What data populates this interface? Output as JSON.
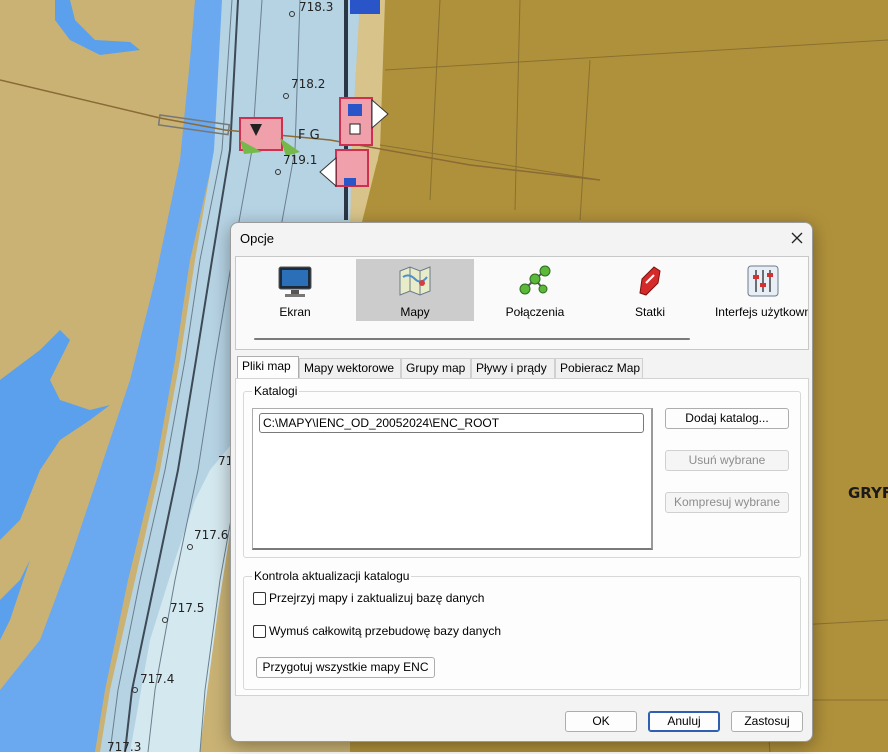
{
  "map": {
    "depth_labels": [
      "718.3",
      "718.2",
      "719.1",
      "717.6",
      "717.5",
      "717.4",
      "717.3",
      "71"
    ],
    "light_label": "F G",
    "place_label": "GRYF"
  },
  "dialog": {
    "title": "Opcje",
    "toolbar": [
      {
        "label": "Ekran",
        "icon": "monitor-icon"
      },
      {
        "label": "Mapy",
        "icon": "map-icon",
        "selected": true
      },
      {
        "label": "Połączenia",
        "icon": "connections-icon"
      },
      {
        "label": "Statki",
        "icon": "ship-icon"
      },
      {
        "label": "Interfejs użytkown",
        "icon": "sliders-icon"
      }
    ],
    "tabs": [
      "Pliki map",
      "Mapy wektorowe",
      "Grupy map",
      "Pływy i prądy",
      "Pobieracz Map"
    ],
    "active_tab": "Pliki map",
    "catalogs": {
      "label": "Katalogi",
      "items": [
        "C:\\MAPY\\IENC_OD_20052024\\ENC_ROOT"
      ],
      "add_button": "Dodaj katalog...",
      "remove_button": "Usuń wybrane",
      "compress_button": "Kompresuj wybrane"
    },
    "update": {
      "label": "Kontrola aktualizacji katalogu",
      "scan_checkbox": "Przejrzyj mapy i zaktualizuj bazę danych",
      "scan_checked": false,
      "rebuild_checkbox": "Wymuś całkowitą przebudowę bazy danych",
      "rebuild_checked": false,
      "prepare_button": "Przygotuj wszystkie mapy ENC"
    },
    "footer": {
      "ok": "OK",
      "cancel": "Anuluj",
      "apply": "Zastosuj"
    }
  },
  "colors": {
    "land": "#c9b274",
    "land_dark": "#b0913b",
    "deep_water": "#6aa8ef",
    "shallow_water": "#b6d3e4",
    "pale_water": "#d4e8ef",
    "accent": "#2f5fb0"
  }
}
